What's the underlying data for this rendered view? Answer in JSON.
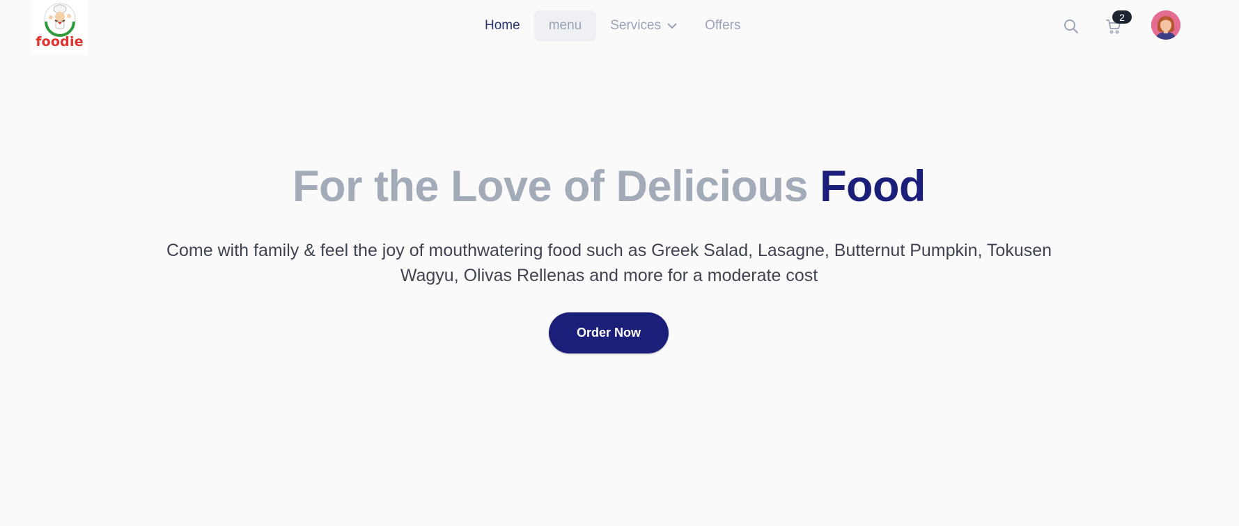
{
  "brand": {
    "name": "foodie",
    "logo_icon": "chef-logo-icon",
    "color": "#e0312a"
  },
  "nav": {
    "items": [
      {
        "label": "Home"
      },
      {
        "label": "menu"
      },
      {
        "label": "Services",
        "icon": "chevron-down-icon"
      },
      {
        "label": "Offers"
      }
    ]
  },
  "header": {
    "search_icon": "search-icon",
    "cart_icon": "cart-icon",
    "cart_count": "2",
    "avatar_icon": "user-avatar"
  },
  "hero": {
    "title_main": "For the Love of Delicious ",
    "title_accent": "Food",
    "subtitle": "Come with family & feel the joy of mouthwatering food such as Greek Salad, Lasagne, Butternut Pumpkin, Tokusen Wagyu, Olivas Rellenas and more for a moderate cost",
    "cta_label": "Order Now"
  },
  "colors": {
    "accent": "#1b1f7a",
    "muted_text": "#a3aab8",
    "background": "#fafafa"
  }
}
